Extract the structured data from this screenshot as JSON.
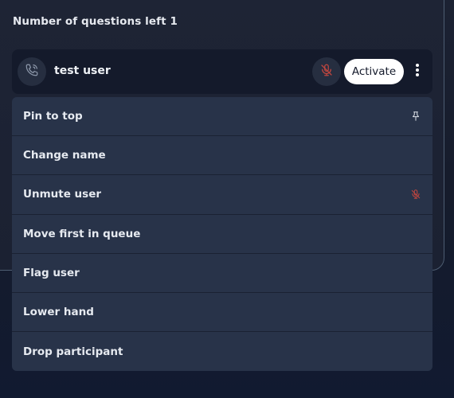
{
  "queue": {
    "questions_left_label": "Number of questions left 1"
  },
  "participant": {
    "name": "test user",
    "activate_label": "Activate",
    "call_icon": "phone-call-icon",
    "mute_icon": "microphone-muted-icon",
    "more_icon": "more-vertical-icon"
  },
  "menu": {
    "items": [
      {
        "label": "Pin to top",
        "icon": "pin-icon"
      },
      {
        "label": "Change name"
      },
      {
        "label": "Unmute user",
        "icon": "microphone-muted-icon"
      },
      {
        "label": "Move first in queue"
      },
      {
        "label": "Flag user"
      },
      {
        "label": "Lower hand"
      },
      {
        "label": "Drop participant"
      }
    ]
  },
  "colors": {
    "background": "#1b2132",
    "row_background": "#141a2b",
    "menu_background": "#283349",
    "muted_red": "#c0463f",
    "button_white": "#ffffff"
  }
}
